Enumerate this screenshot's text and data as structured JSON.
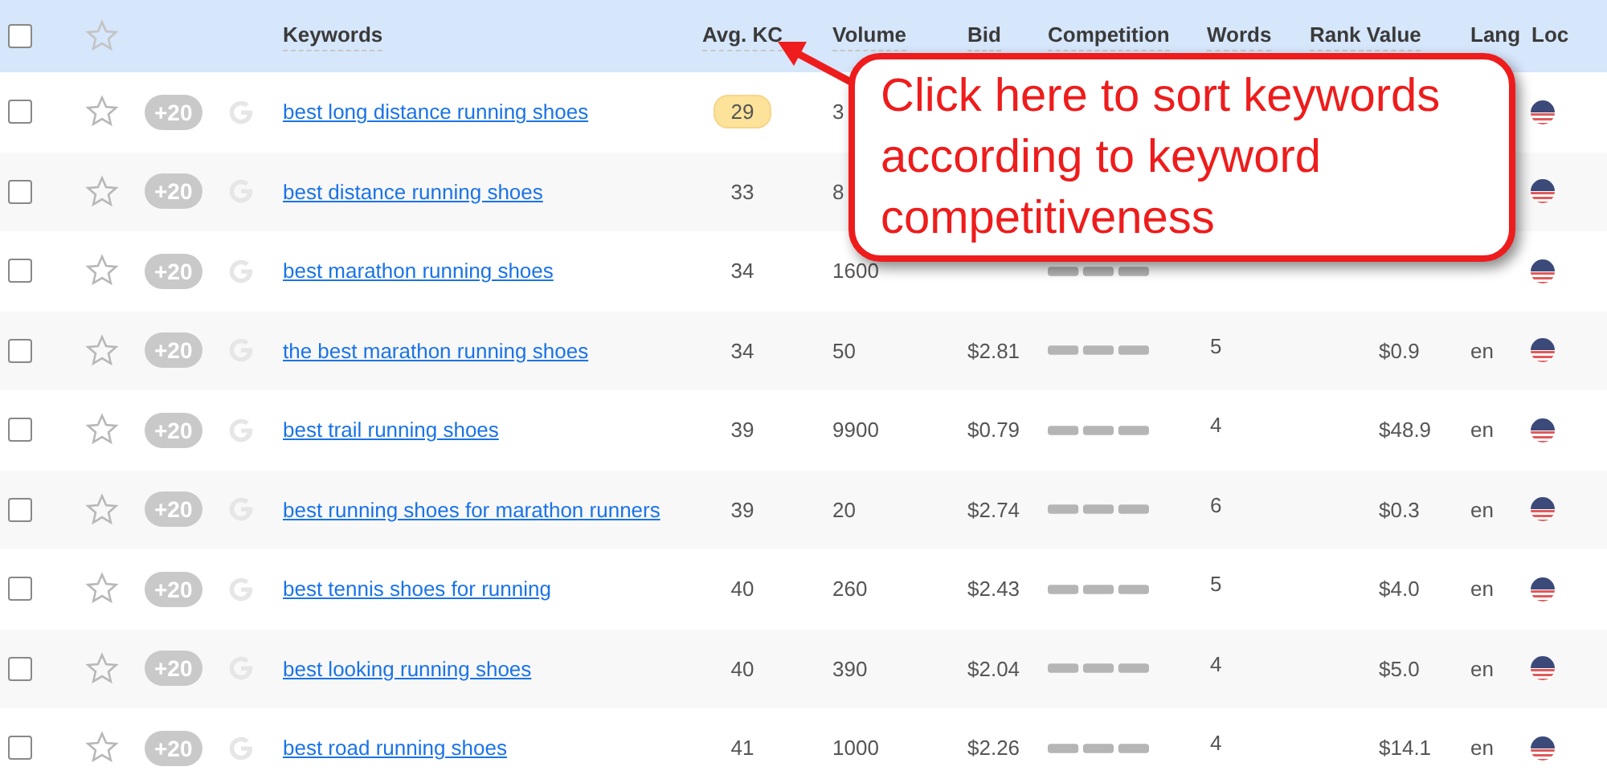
{
  "table": {
    "header": {
      "select_all_checked": false,
      "columns": [
        {
          "label": "Keywords",
          "sortable": true
        },
        {
          "label": "Avg. KC",
          "sortable": true
        },
        {
          "label": "Volume",
          "sortable": true
        },
        {
          "label": "Bid",
          "sortable": true
        },
        {
          "label": "Competition",
          "sortable": true
        },
        {
          "label": "Words",
          "sortable": true
        },
        {
          "label": "Rank Value",
          "sortable": true
        },
        {
          "label": "Lang",
          "sortable": false
        },
        {
          "label": "Loc",
          "sortable": false
        }
      ]
    },
    "rows": [
      {
        "checked": false,
        "starred": false,
        "badge": "+20",
        "keyword": "best long distance running shoes",
        "kc": "29",
        "kc_highlighted": true,
        "volume": "3"
      },
      {
        "checked": false,
        "starred": false,
        "badge": "+20",
        "keyword": "best distance running shoes",
        "kc": "33",
        "kc_highlighted": false,
        "volume": "8"
      },
      {
        "checked": false,
        "starred": false,
        "badge": "+20",
        "keyword": "best marathon running shoes",
        "kc": "34",
        "kc_highlighted": false,
        "volume": "1600",
        "competition": true
      },
      {
        "checked": false,
        "starred": false,
        "badge": "+20",
        "keyword": "the best marathon running shoes",
        "kc": "34",
        "kc_highlighted": false,
        "volume": "50",
        "bid": "$2.81",
        "competition": true,
        "words": "5",
        "rank_value": "$0.9",
        "lang": "en"
      },
      {
        "checked": false,
        "starred": false,
        "badge": "+20",
        "keyword": "best trail running shoes",
        "kc": "39",
        "kc_highlighted": false,
        "volume": "9900",
        "bid": "$0.79",
        "competition": true,
        "words": "4",
        "rank_value": "$48.9",
        "lang": "en"
      },
      {
        "checked": false,
        "starred": false,
        "badge": "+20",
        "keyword": "best running shoes for marathon runners",
        "kc": "39",
        "kc_highlighted": false,
        "volume": "20",
        "bid": "$2.74",
        "competition": true,
        "words": "6",
        "rank_value": "$0.3",
        "lang": "en"
      },
      {
        "checked": false,
        "starred": false,
        "badge": "+20",
        "keyword": "best tennis shoes for running",
        "kc": "40",
        "kc_highlighted": false,
        "volume": "260",
        "bid": "$2.43",
        "competition": true,
        "words": "5",
        "rank_value": "$4.0",
        "lang": "en"
      },
      {
        "checked": false,
        "starred": false,
        "badge": "+20",
        "keyword": "best looking running shoes",
        "kc": "40",
        "kc_highlighted": false,
        "volume": "390",
        "bid": "$2.04",
        "competition": true,
        "words": "4",
        "rank_value": "$5.0",
        "lang": "en"
      },
      {
        "checked": false,
        "starred": false,
        "badge": "+20",
        "keyword": "best road running shoes",
        "kc": "41",
        "kc_highlighted": false,
        "volume": "1000",
        "bid": "$2.26",
        "competition": true,
        "words": "4",
        "rank_value": "$14.1",
        "lang": "en"
      }
    ]
  },
  "callout": {
    "text": "Click here to sort keywords according to keyword competitiveness"
  }
}
